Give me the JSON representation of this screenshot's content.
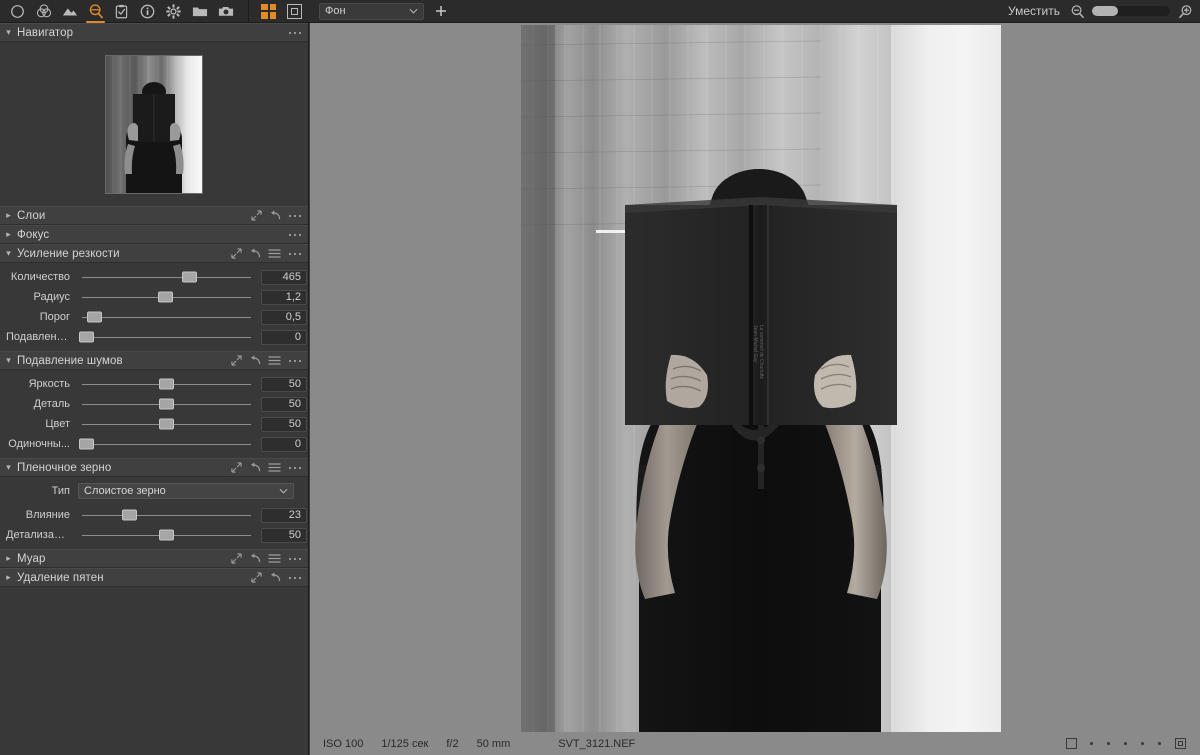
{
  "toolbar": {
    "tools": [
      {
        "name": "circle-tool-icon",
        "label": "Круг"
      },
      {
        "name": "color-balance-icon",
        "label": "Цвет"
      },
      {
        "name": "landscape-icon",
        "label": "Пейзаж"
      },
      {
        "name": "magnifier-detail-icon",
        "label": "Детали",
        "active": true
      },
      {
        "name": "clipboard-check-icon",
        "label": "Буфер"
      },
      {
        "name": "info-icon",
        "label": "Информация"
      },
      {
        "name": "gear-icon",
        "label": "Настройки"
      },
      {
        "name": "folder-icon",
        "label": "Папка"
      },
      {
        "name": "camera-icon",
        "label": "Камера"
      }
    ],
    "view_grid_icon": "grid-view-icon",
    "view_single_icon": "single-view-icon",
    "layer_select_value": "Фон",
    "add_layer_icon": "add-layer-icon",
    "fit_label": "Уместить",
    "zoom_out_icon": "zoom-out-icon",
    "zoom_in_icon": "zoom-in-icon",
    "zoom_slider_value": 0
  },
  "panel": {
    "sections": [
      {
        "id": "navigator",
        "title": "Навигатор",
        "expanded": true,
        "actions": [
          "ellipsis-icon"
        ]
      },
      {
        "id": "layers",
        "title": "Слои",
        "expanded": false,
        "actions": [
          "expand-icon",
          "reset-icon",
          "ellipsis-icon"
        ]
      },
      {
        "id": "focus",
        "title": "Фокус",
        "expanded": false,
        "actions": [
          "ellipsis-icon"
        ]
      },
      {
        "id": "sharpening",
        "title": "Усиление резкости",
        "expanded": true,
        "actions": [
          "expand-icon",
          "reset-icon",
          "menu-icon",
          "ellipsis-icon"
        ],
        "rows": [
          {
            "label": "Количество",
            "value": "465",
            "pos": 63
          },
          {
            "label": "Радиус",
            "value": "1,2",
            "pos": 48
          },
          {
            "label": "Порог",
            "value": "0,5",
            "pos": 5
          },
          {
            "label": "Подавлени...",
            "value": "0",
            "pos": 0
          }
        ]
      },
      {
        "id": "noise",
        "title": "Подавление шумов",
        "expanded": true,
        "actions": [
          "expand-icon",
          "reset-icon",
          "menu-icon",
          "ellipsis-icon"
        ],
        "rows": [
          {
            "label": "Яркость",
            "value": "50",
            "pos": 50
          },
          {
            "label": "Деталь",
            "value": "50",
            "pos": 50
          },
          {
            "label": "Цвет",
            "value": "50",
            "pos": 50
          },
          {
            "label": "Одиночны...",
            "value": "0",
            "pos": 0
          }
        ]
      },
      {
        "id": "grain",
        "title": "Пленочное зерно",
        "expanded": true,
        "actions": [
          "expand-icon",
          "reset-icon",
          "menu-icon",
          "ellipsis-icon"
        ],
        "combo": {
          "label": "Тип",
          "value": "Слоистое зерно"
        },
        "rows": [
          {
            "label": "Влияние",
            "value": "23",
            "pos": 27
          },
          {
            "label": "Детализация",
            "value": "50",
            "pos": 50
          }
        ]
      },
      {
        "id": "moire",
        "title": "Муар",
        "expanded": false,
        "actions": [
          "expand-icon",
          "reset-icon",
          "menu-icon",
          "ellipsis-icon"
        ]
      },
      {
        "id": "spot-removal",
        "title": "Удаление пятен",
        "expanded": false,
        "actions": [
          "expand-icon",
          "reset-icon",
          "ellipsis-icon"
        ]
      }
    ]
  },
  "statusbar": {
    "iso": "ISO 100",
    "shutter": "1/125 сек",
    "aperture": "f/2",
    "focal": "50 mm",
    "filename": "SVT_3121.NEF",
    "rating_dots": 5,
    "crop_icon": "crop-square-icon",
    "grid_icon": "grid-overlay-icon"
  },
  "colors": {
    "accent": "#e08a28",
    "panel_bg": "#383838",
    "header_bg": "#404040",
    "topbar_bg": "#2b2b2b",
    "viewer_bg": "#8a8a8a"
  }
}
